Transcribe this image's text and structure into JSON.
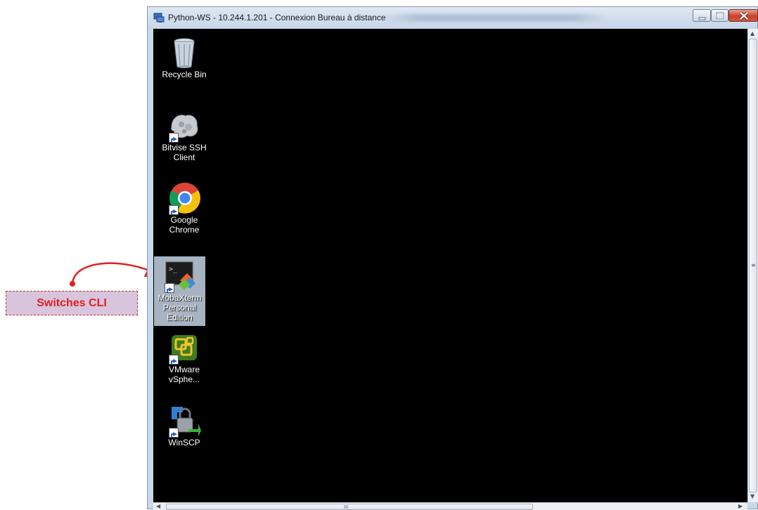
{
  "window": {
    "title": "Python-WS - 10.244.1.201 - Connexion Bureau à distance"
  },
  "desktop": {
    "icons": [
      {
        "label_lines": [
          "Recycle Bin"
        ],
        "icon": "recycle-bin-icon"
      },
      {
        "label_lines": [
          "Bitvise SSH",
          "Client"
        ],
        "icon": "bitvise-ssh-icon"
      },
      {
        "label_lines": [
          "Google",
          "Chrome"
        ],
        "icon": "chrome-icon"
      },
      {
        "label_lines": [
          "MobaXterm",
          "Personal",
          "Edition"
        ],
        "icon": "mobaxterm-icon",
        "selected": true
      },
      {
        "label_lines": [
          "VMware",
          "vSphe..."
        ],
        "icon": "vmware-vsphere-icon"
      },
      {
        "label_lines": [
          "WinSCP"
        ],
        "icon": "winscp-icon"
      }
    ]
  },
  "annotation": {
    "text": "Switches CLI",
    "color": "#e02020"
  },
  "scrollbar": {
    "grip": "≡",
    "hgrip": "III"
  }
}
